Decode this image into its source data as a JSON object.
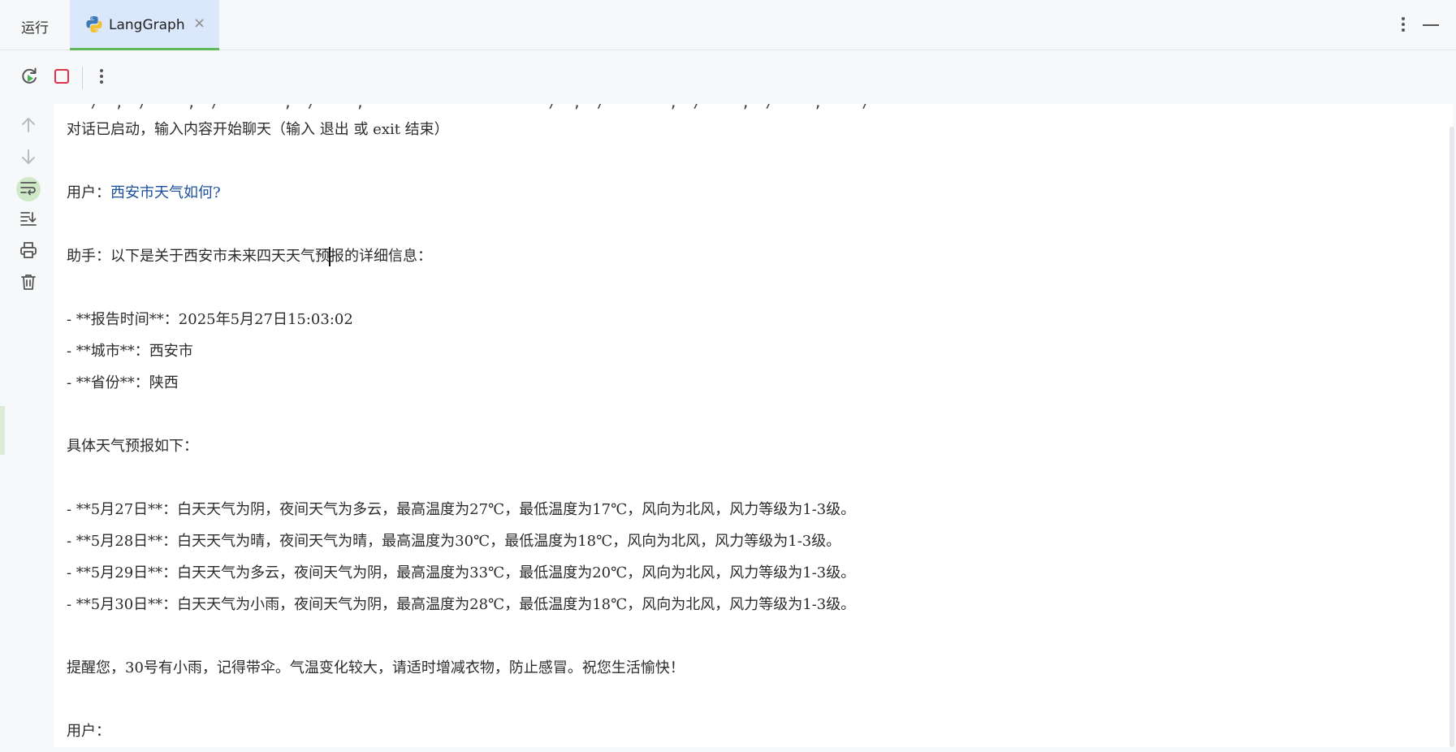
{
  "tabbar": {
    "run_label": "运行",
    "tab_label": "LangGraph",
    "close_glyph": "×",
    "tab_icon": "python-icon",
    "accent": "#5fb85a",
    "tab_bg": "#dbe7fb"
  },
  "toolbar": {
    "icons": [
      "rerun-icon",
      "stop-icon",
      "more-vertical-icon"
    ],
    "stop_color": "#e0334a"
  },
  "gutter": {
    "icons": [
      "arrow-up-icon",
      "arrow-down-icon",
      "soft-wrap-icon",
      "scroll-to-end-icon",
      "print-icon",
      "trash-icon"
    ]
  },
  "console": {
    "start_line": "对话已启动，输入内容开始聊天（输入 退出 或 exit 结束）",
    "user1_prefix": "用户：",
    "user1_text": "西安市天气如何?",
    "assistant_prefix": "助手：",
    "assistant_intro_a": "以下是关于西安市未来四天天气预",
    "assistant_intro_b": "报的详细信息：",
    "report_time": "- **报告时间**：2025年5月27日15:03:02",
    "city": "- **城市**：西安市",
    "province": "- **省份**：陕西",
    "forecast_heading": "具体天气预报如下：",
    "forecast": [
      "- **5月27日**：白天天气为阴，夜间天气为多云，最高温度为27℃，最低温度为17℃，风向为北风，风力等级为1-3级。",
      "- **5月28日**：白天天气为晴，夜间天气为晴，最高温度为30℃，最低温度为18℃，风向为北风，风力等级为1-3级。",
      "- **5月29日**：白天天气为多云，夜间天气为阴，最高温度为33℃，最低温度为20℃，风向为北风，风力等级为1-3级。",
      "- **5月30日**：白天天气为小雨，夜间天气为阴，最高温度为28℃，最低温度为18℃，风向为北风，风力等级为1-3级。"
    ],
    "reminder": "提醒您，30号有小雨，记得带伞。气温变化较大，请适时增减衣物，防止感冒。祝您生活愉快！",
    "user2_prefix": "用户："
  }
}
